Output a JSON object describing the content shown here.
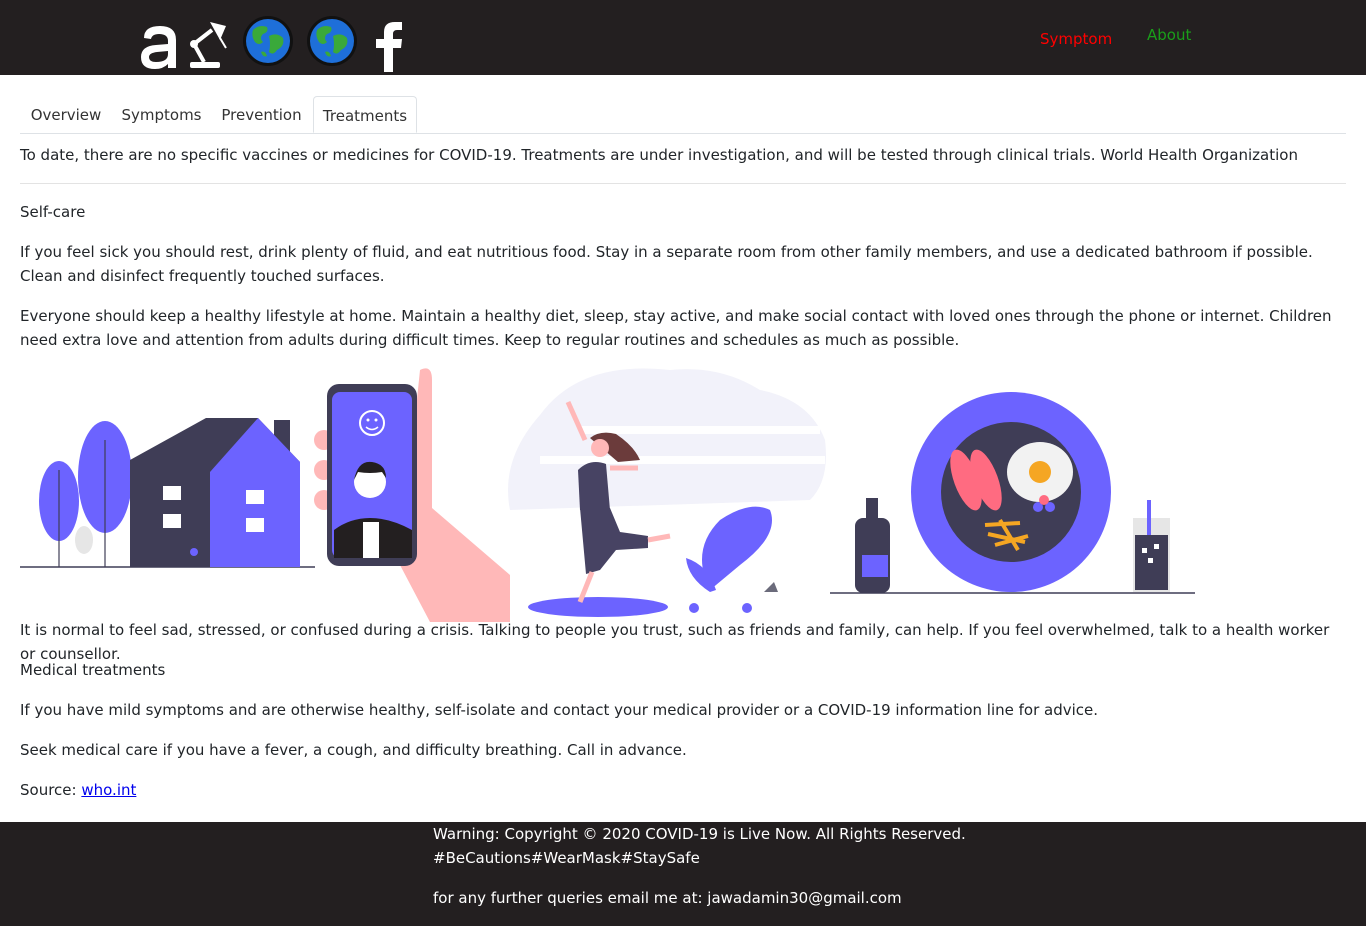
{
  "nav": {
    "symptom_label": "Symptom",
    "about_label": "About",
    "logo_letter": "a"
  },
  "tabs": [
    {
      "label": "Overview"
    },
    {
      "label": "Symptoms"
    },
    {
      "label": "Prevention"
    },
    {
      "label": "Treatments"
    }
  ],
  "content": {
    "intro": "To date, there are no specific vaccines or medicines for COVID-19. Treatments are under investigation, and will be tested through clinical trials. World Health Organization",
    "selfcare_heading": "Self-care",
    "p1": "If you feel sick you should rest, drink plenty of fluid, and eat nutritious food. Stay in a separate room from other family members, and use a dedicated bathroom if possible. Clean and disinfect frequently touched surfaces.",
    "p2": "Everyone should keep a healthy lifestyle at home. Maintain a healthy diet, sleep, stay active, and make social contact with loved ones through the phone or internet. Children need extra love and attention from adults during difficult times. Keep to regular routines and schedules as much as possible.",
    "p3": "It is normal to feel sad, stressed, or confused during a crisis. Talking to people you trust, such as friends and family, can help. If you feel overwhelmed, talk to a health worker or counsellor.",
    "medical_heading": "Medical treatments",
    "p4": "If you have mild symptoms and are otherwise healthy, self-isolate and contact your medical provider or a COVID-19 information line for advice.",
    "p5": "Seek medical care if you have a fever, a cough, and difficulty breathing. Call in advance.",
    "source_label": "Source:",
    "source_link": "who.int"
  },
  "footer": {
    "line1": "Warning: Copyright © 2020 COVID-19 is Live Now. All Rights Reserved.",
    "line2": "#BeCautions#WearMask#StaySafe",
    "line3": "for any further queries email me at: jawadamin30@gmail.com"
  },
  "colors": {
    "bar": "#231f20",
    "accent_purple": "#6c63ff",
    "dark_navy": "#3f3d56",
    "pink": "#ffb8b8",
    "symptom_red": "#ff0000",
    "about_green": "#1a9e1a"
  },
  "icons": [
    "logo-a",
    "desk-lamp-icon",
    "globe-icon",
    "globe-icon",
    "facebook-icon"
  ]
}
